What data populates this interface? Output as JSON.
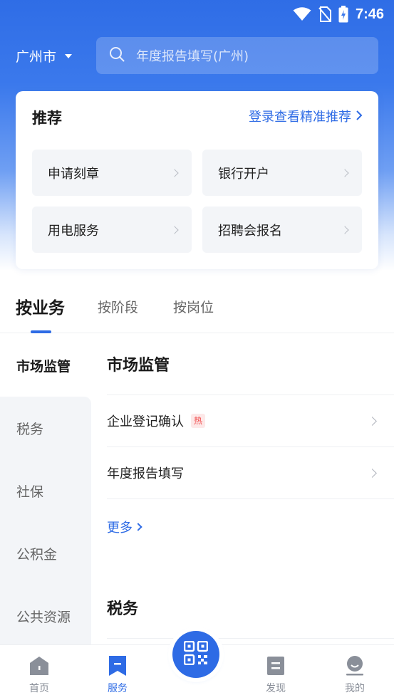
{
  "status": {
    "time": "7:46"
  },
  "header": {
    "city": "广州市",
    "search_placeholder": "年度报告填写(广州)"
  },
  "recommend": {
    "title": "推荐",
    "login_link": "登录查看精准推荐",
    "items": [
      {
        "label": "申请刻章"
      },
      {
        "label": "银行开户"
      },
      {
        "label": "用电服务"
      },
      {
        "label": "招聘会报名"
      }
    ]
  },
  "tabs": [
    {
      "label": "按业务",
      "active": true
    },
    {
      "label": "按阶段",
      "active": false
    },
    {
      "label": "按岗位",
      "active": false
    }
  ],
  "sidebar": {
    "items": [
      {
        "label": "市场监管",
        "active": true
      },
      {
        "label": "税务",
        "active": false
      },
      {
        "label": "社保",
        "active": false
      },
      {
        "label": "公积金",
        "active": false
      },
      {
        "label": "公共资源",
        "active": false
      }
    ]
  },
  "content": {
    "sections": [
      {
        "title": "市场监管",
        "rows": [
          {
            "label": "企业登记确认",
            "badge": "热"
          },
          {
            "label": "年度报告填写"
          }
        ],
        "more": "更多"
      },
      {
        "title": "税务"
      }
    ]
  },
  "bottom_nav": {
    "items": [
      {
        "label": "首页",
        "icon": "home-icon",
        "active": false
      },
      {
        "label": "服务",
        "icon": "bookmark-icon",
        "active": true
      },
      {
        "label": "",
        "icon": "qr-scan-icon",
        "active": false
      },
      {
        "label": "发现",
        "icon": "discover-icon",
        "active": false
      },
      {
        "label": "我的",
        "icon": "profile-icon",
        "active": false
      }
    ]
  },
  "colors": {
    "primary": "#2e6be5",
    "hot": "#f04b4b"
  }
}
